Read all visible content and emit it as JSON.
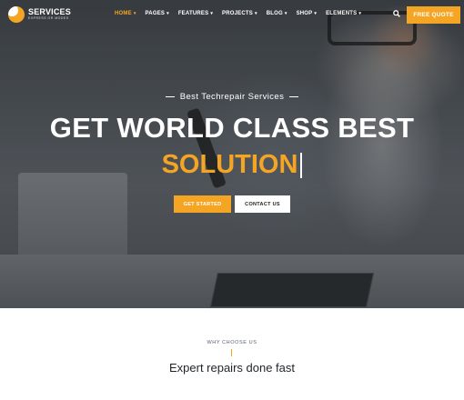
{
  "brand": {
    "name": "SERVICES",
    "tagline": "EXPRESS OR MODES",
    "accent_color": "#f5a524",
    "icon": "logo-swirl-icon"
  },
  "nav": {
    "items": [
      {
        "label": "HOME",
        "active": true,
        "has_dropdown": true
      },
      {
        "label": "PAGES",
        "active": false,
        "has_dropdown": true
      },
      {
        "label": "FEATURES",
        "active": false,
        "has_dropdown": true
      },
      {
        "label": "PROJECTS",
        "active": false,
        "has_dropdown": true
      },
      {
        "label": "BLOG",
        "active": false,
        "has_dropdown": true
      },
      {
        "label": "SHOP",
        "active": false,
        "has_dropdown": true
      },
      {
        "label": "ELEMENTS",
        "active": false,
        "has_dropdown": true
      }
    ],
    "search_icon": "search-icon",
    "cta_label": "FREE QUOTE"
  },
  "hero": {
    "subtitle": "Best Techrepair Services",
    "headline_line1": "GET WORLD CLASS BEST",
    "headline_line2": "SOLUTION",
    "primary_button": "GET STARTED",
    "secondary_button": "CONTACT US"
  },
  "why": {
    "label": "WHY CHOOSE US",
    "title": "Expert repairs done fast"
  }
}
